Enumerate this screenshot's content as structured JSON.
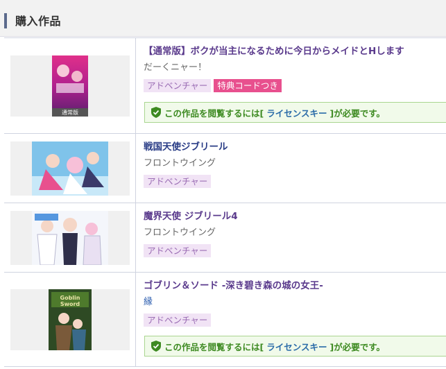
{
  "section": {
    "title": "購入作品"
  },
  "items": [
    {
      "title": "【通常版】ボクが当主になるために今日からメイドとHします",
      "brand": "だーくニャー！",
      "tags": [
        "アドベンチャー"
      ],
      "special_tag": "特典コードつき",
      "cover_label": "通常版",
      "license": {
        "before": "この作品を閲覧するには[",
        "key": "ライセンスキー",
        "after": "]が必要です。"
      }
    },
    {
      "title": "戦国天使ジブリール",
      "brand": "フロントウイング",
      "tags": [
        "アドベンチャー"
      ]
    },
    {
      "title": "魔界天使 ジブリール4",
      "brand": "フロントウイング",
      "tags": [
        "アドベンチャー"
      ]
    },
    {
      "title": "ゴブリン＆ソード -深き碧き森の城の女王-",
      "brand": "縁",
      "tags": [
        "アドベンチャー"
      ],
      "license": {
        "before": "この作品を閲覧するには[",
        "key": "ライセンスキー",
        "after": "]が必要です。"
      }
    }
  ],
  "colors": {
    "accent_bar": "#5b6a8c",
    "title_link": "#2a3d86",
    "tag_bg": "#f1e3f5",
    "special_tag_bg": "#e8508e",
    "license_bg": "#f1faea",
    "license_text": "#3d8a21"
  }
}
